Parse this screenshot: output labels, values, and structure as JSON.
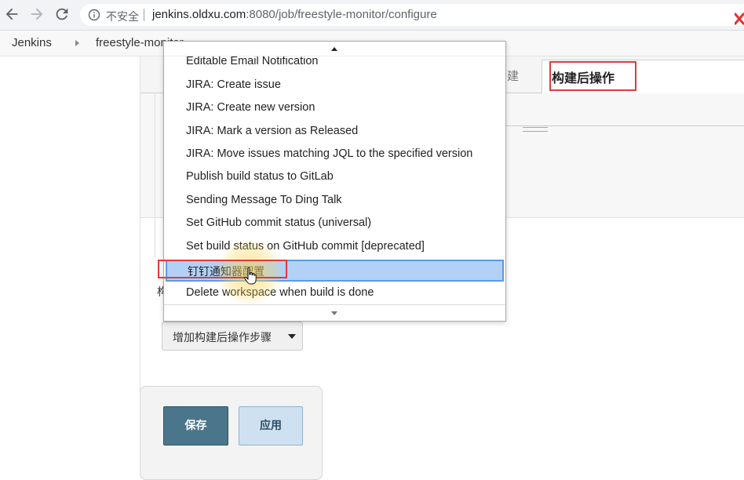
{
  "browser": {
    "security_label": "不安全",
    "url_host": "jenkins.oldxu.com",
    "url_rest": ":8080/job/freestyle-monitor/configure"
  },
  "breadcrumb": {
    "items": [
      "Jenkins",
      "freestyle-monitor"
    ]
  },
  "tabs": {
    "prev_label": "建",
    "active_label": "构建后操作"
  },
  "section": {
    "label": "构"
  },
  "dropdown": {
    "clipped_top": "Editable Email Notification",
    "items": [
      "JIRA: Create issue",
      "JIRA: Create new version",
      "JIRA: Mark a version as Released",
      "JIRA: Move issues matching JQL to the specified version",
      "Publish build status to GitLab",
      "Sending Message To Ding Talk",
      "Set GitHub commit status (universal)",
      "Set build status on GitHub commit [deprecated]"
    ],
    "selected": "钉钉通知器配置",
    "after_selected": "Delete workspace when build is done"
  },
  "add_step_button": "增加构建后操作步骤",
  "actions": {
    "save": "保存",
    "apply": "应用"
  },
  "colors": {
    "highlight": "#b3d1f7",
    "annotation_red": "#e53935",
    "save_bg": "#4b758b",
    "apply_bg": "#cfe1f0"
  }
}
